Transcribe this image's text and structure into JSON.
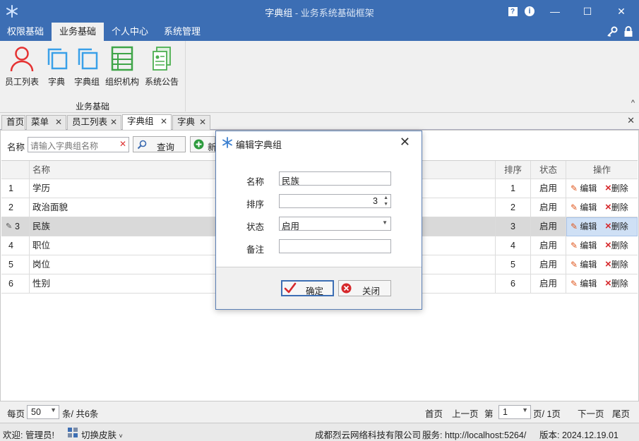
{
  "window": {
    "title": "字典组",
    "subtitle": " - 业务系统基础框架",
    "buttons": {
      "help": "?",
      "info": "i",
      "minimize": "—",
      "maximize": "☐",
      "close": "✕"
    }
  },
  "menubar": {
    "items": [
      {
        "label": "权限基础"
      },
      {
        "label": "业务基础"
      },
      {
        "label": "个人中心"
      },
      {
        "label": "系统管理"
      }
    ]
  },
  "ribbon": {
    "buttons": [
      {
        "label": "员工列表",
        "icon": "user-icon"
      },
      {
        "label": "字典",
        "icon": "copy-icon"
      },
      {
        "label": "字典组",
        "icon": "copy-icon"
      },
      {
        "label": "组织机构",
        "icon": "org-icon"
      },
      {
        "label": "系统公告",
        "icon": "notice-icon"
      }
    ],
    "group_label": "业务基础",
    "collapse": "^"
  },
  "tabs": [
    {
      "label": "首页"
    },
    {
      "label": "菜单",
      "close": "✕"
    },
    {
      "label": "员工列表",
      "close": "✕"
    },
    {
      "label": "字典组",
      "close": "✕"
    },
    {
      "label": "字典",
      "close": "✕"
    }
  ],
  "tabs_close_all": "✕",
  "search": {
    "label": "名称",
    "placeholder": "请输入字典组名称",
    "clear": "✕",
    "query_label": "查询",
    "add_label": "新"
  },
  "grid": {
    "headers": {
      "name": "名称",
      "sort": "排序",
      "status": "状态",
      "ops": "操作"
    },
    "rows": [
      {
        "no": "1",
        "name": "学历",
        "sort": "1",
        "status": "启用"
      },
      {
        "no": "2",
        "name": "政治面貌",
        "sort": "2",
        "status": "启用"
      },
      {
        "no": "3",
        "name": "民族",
        "sort": "3",
        "status": "启用"
      },
      {
        "no": "4",
        "name": "职位",
        "sort": "4",
        "status": "启用"
      },
      {
        "no": "5",
        "name": "岗位",
        "sort": "5",
        "status": "启用"
      },
      {
        "no": "6",
        "name": "性别",
        "sort": "6",
        "status": "启用"
      }
    ],
    "edit_label": "编辑",
    "delete_label": "删除",
    "edit_indicator": "✎"
  },
  "pager": {
    "per_page_label": "每页",
    "per_page_value": "50",
    "total_text": "条/ 共6条",
    "first": "首页",
    "prev": "上一页",
    "page_prefix": "第",
    "page_value": "1",
    "page_suffix": "页/ 1页",
    "next": "下一页",
    "last": "尾页"
  },
  "statusbar": {
    "welcome": "欢迎: 管理员!",
    "skin": "切换皮肤",
    "company": "成都烈云网络科技有限公司",
    "service": "服务: http://localhost:5264/",
    "version": "版本: 2024.12.19.01"
  },
  "dialog": {
    "title": "编辑字典组",
    "close": "✕",
    "fields": {
      "name_label": "名称",
      "name_value": "民族",
      "sort_label": "排序",
      "sort_value": "3",
      "status_label": "状态",
      "status_value": "启用",
      "remark_label": "备注",
      "remark_value": ""
    },
    "ok_label": "确定",
    "cancel_label": "关闭"
  },
  "colors": {
    "accent": "#3c6eb4",
    "ribbon_bg": "#f0f0f0",
    "selected_row": "#d9d9d9"
  }
}
